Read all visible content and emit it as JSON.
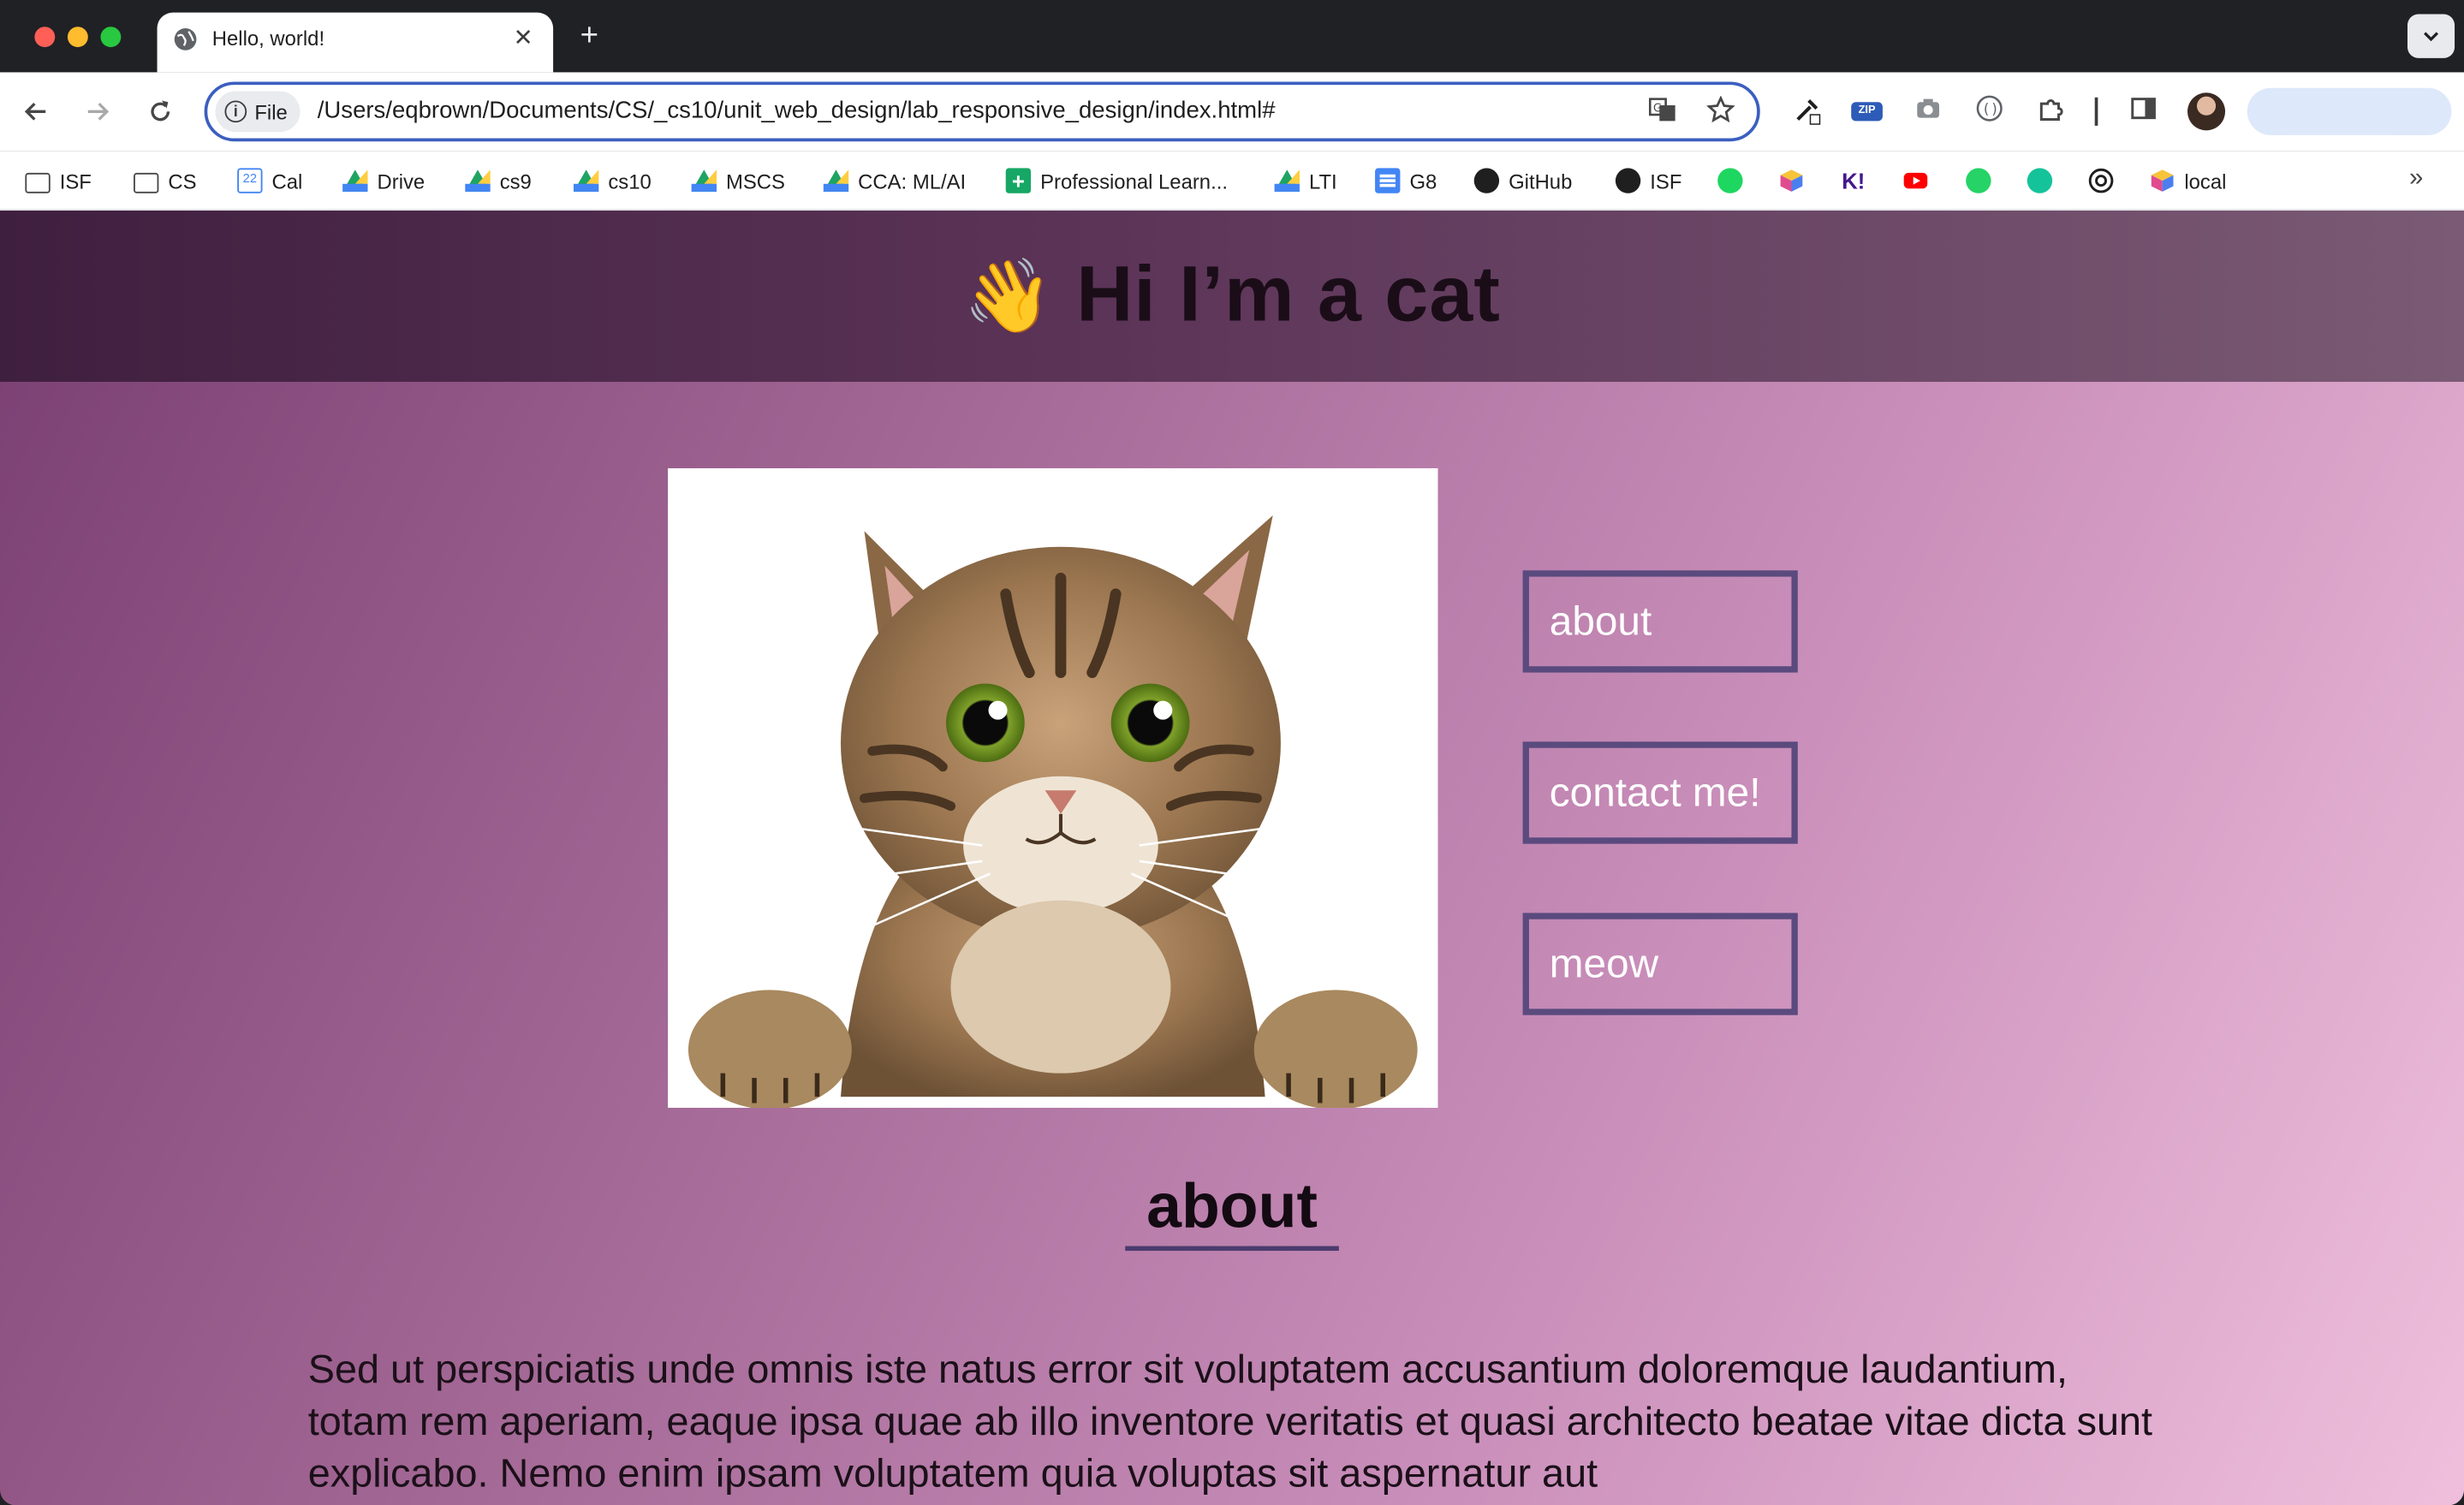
{
  "browser": {
    "tab_title": "Hello, world!",
    "new_tab_glyph": "+",
    "close_glyph": "✕",
    "file_chip_label": "File",
    "url": "/Users/eqbrown/Documents/CS/_cs10/unit_web_design/lab_responsive_design/index.html#",
    "icons": [
      "back-icon",
      "forward-icon",
      "reload-icon",
      "info-icon",
      "translate-icon",
      "star-icon",
      "eyedropper-icon",
      "zip-icon",
      "camera-icon",
      "extension-icon",
      "puzzle-icon",
      "side-panel-icon",
      "avatar"
    ],
    "zip_label": "ZIP"
  },
  "bookmarks": [
    {
      "label": "ISF",
      "icon": "folder-icon"
    },
    {
      "label": "CS",
      "icon": "folder-icon"
    },
    {
      "label": "Cal",
      "icon": "calendar-icon"
    },
    {
      "label": "Drive",
      "icon": "drive-icon"
    },
    {
      "label": "cs9",
      "icon": "drive-icon"
    },
    {
      "label": "cs10",
      "icon": "drive-icon"
    },
    {
      "label": "MSCS",
      "icon": "drive-icon"
    },
    {
      "label": "CCA: ML/AI",
      "icon": "drive-icon"
    },
    {
      "label": "Professional Learn...",
      "icon": "plus-sheet-icon"
    },
    {
      "label": "LTI",
      "icon": "drive-icon"
    },
    {
      "label": "G8",
      "icon": "docs-icon"
    },
    {
      "label": "GitHub",
      "icon": "github-icon"
    },
    {
      "label": "ISF",
      "icon": "github-icon"
    },
    {
      "label": "local",
      "icon": "cube-icon"
    }
  ],
  "bookmark_icons_only": [
    "spotify-icon",
    "cube-icon",
    "kahoot-icon",
    "youtube-icon",
    "whatsapp-icon",
    "grammarly-icon",
    "chatgpt-icon"
  ],
  "kahoot_label": "K!",
  "page": {
    "wave_emoji": "👋",
    "title": "Hi I’m a cat",
    "nav": [
      "about",
      "contact me!",
      "meow"
    ],
    "section_title": "about",
    "about_text": "Sed ut perspiciatis unde omnis iste natus error sit voluptatem accusantium doloremque laudantium, totam rem aperiam, eaque ipsa quae ab illo inventore veritatis et quasi architecto beatae vitae dicta sunt explicabo. Nemo enim ipsam voluptatem quia voluptas sit aspernatur aut"
  },
  "colors": {
    "header_bg": "#4b2848",
    "page_gradient_start": "#7a3f72",
    "page_gradient_end": "#efbfdc",
    "nav_border": "#5a4a7e",
    "omnibox_focus": "#3b5fc0"
  }
}
